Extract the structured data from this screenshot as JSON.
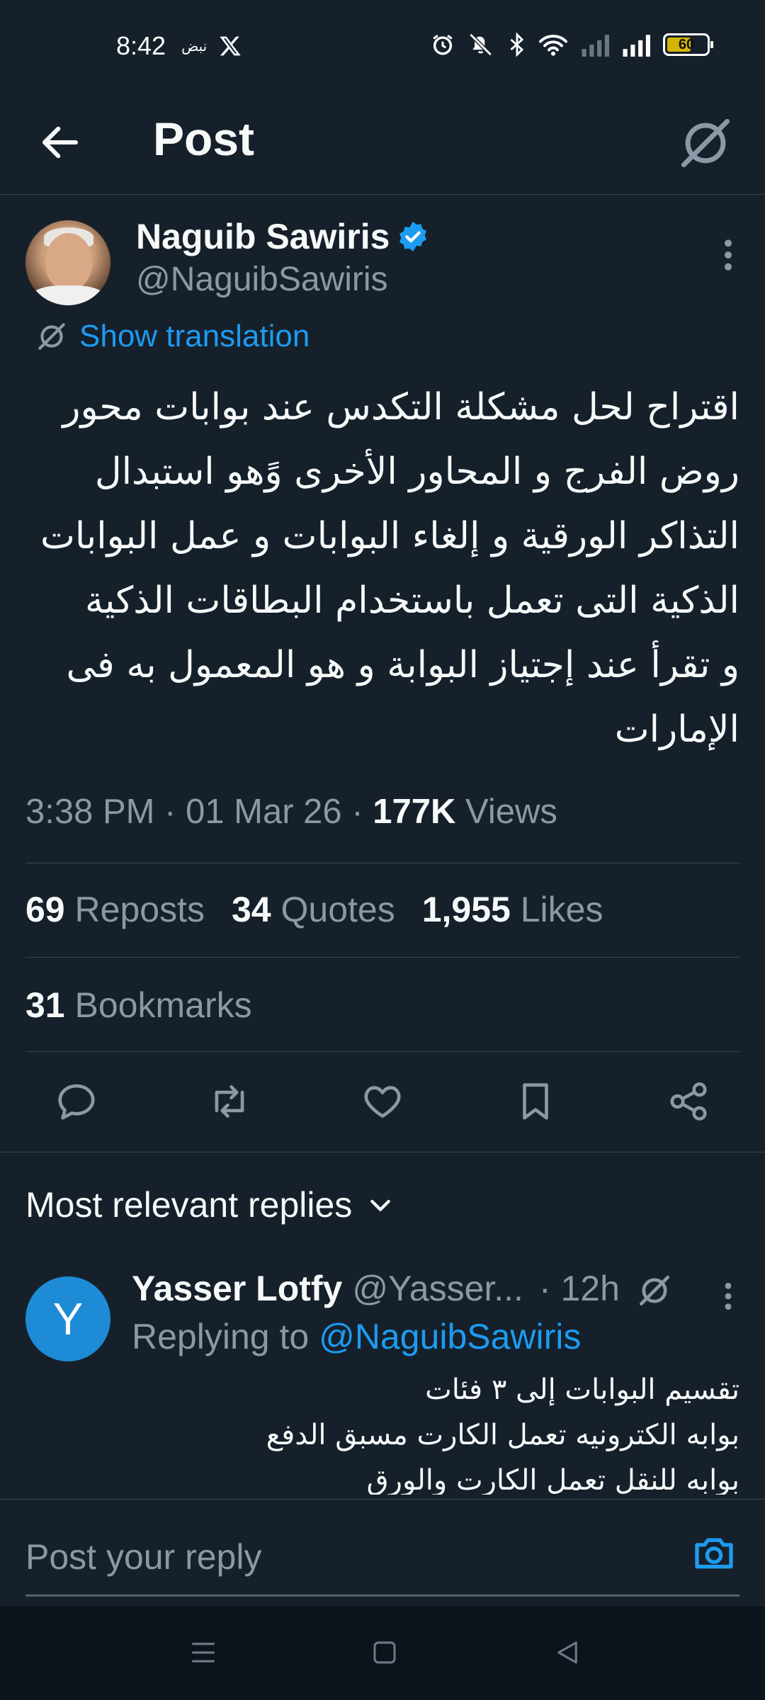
{
  "status_bar": {
    "time": "8:42",
    "small_text": "نبض",
    "battery_level": "60",
    "icons": [
      "x-logo-icon",
      "alarm-icon",
      "mute-icon",
      "bluetooth-icon",
      "wifi-icon",
      "signal-icon",
      "signal-icon",
      "battery-icon"
    ]
  },
  "header": {
    "title": "Post",
    "back_icon": "arrow-left-icon",
    "translate_icon": "translate-icon"
  },
  "post": {
    "author_name": "Naguib Sawiris",
    "author_handle": "@NaguibSawiris",
    "verified_icon": "verified-badge-icon",
    "show_translation": "Show translation",
    "text_lines": [
      "اقتراح لحل مشكلة التكدس عند بوابات محور",
      "روض الفرج و المحاور الأخرى وًهو  استبدال",
      "التذاكر الورقية و إلغاء البوابات و عمل البوابات",
      "الذكية التى تعمل باستخدام البطاقات الذكية",
      "و تقرأ عند إجتياز  البوابة و هو المعمول به فى",
      "الإمارات"
    ],
    "time": "3:38 PM",
    "date": "01 Mar 26",
    "separator": "·",
    "views_count": "177K",
    "views_label": "Views",
    "reposts_count": "69",
    "reposts_label": "Reposts",
    "quotes_count": "34",
    "quotes_label": "Quotes",
    "likes_count": "1,955",
    "likes_label": "Likes",
    "bookmarks_count": "31",
    "bookmarks_label": "Bookmarks"
  },
  "actions": [
    "reply-icon",
    "repost-icon",
    "like-icon",
    "bookmark-icon",
    "share-icon"
  ],
  "replies_header": {
    "label": "Most relevant replies",
    "icon": "chevron-down-icon"
  },
  "reply": {
    "avatar_letter": "Y",
    "name": "Yasser Lotfy",
    "handle": "@Yasser...",
    "time": "· 12h",
    "replying_prefix": "Replying to",
    "replying_handle": "@NaguibSawiris",
    "text_lines": [
      "تقسيم البوابات إلى ٣ فئات",
      "بوابه الكترونيه تعمل الكارت مسبق الدفع",
      "بوابه للنقل تعمل الكارت والورق"
    ]
  },
  "composer": {
    "placeholder": "Post your reply",
    "camera_icon": "camera-icon"
  },
  "nav_bar": [
    "menu-icon",
    "home-square-icon",
    "back-triangle-icon"
  ],
  "colors": {
    "background": "#15202b",
    "accent": "#1d9bf0",
    "muted_text": "#8b98a5",
    "divider": "#38444d"
  }
}
